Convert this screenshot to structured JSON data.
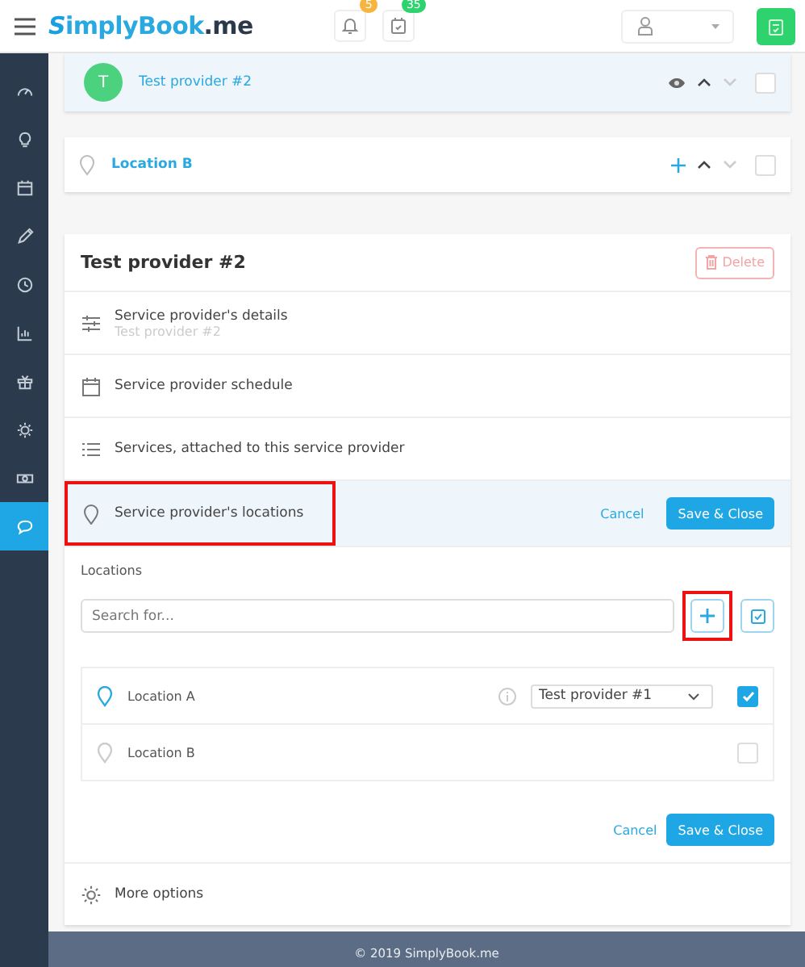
{
  "header": {
    "logo": {
      "first": "S",
      "brand": "implyBook",
      ".me": ".me"
    },
    "notifications": {
      "count": "5"
    },
    "bookings": {
      "count": "35"
    }
  },
  "sidebar": {
    "items": [
      {
        "selected": false
      },
      {
        "selected": false
      },
      {
        "selected": false
      },
      {
        "selected": false
      },
      {
        "selected": false
      },
      {
        "selected": false
      },
      {
        "selected": false
      },
      {
        "selected": false
      },
      {
        "selected": false
      },
      {
        "selected": true
      }
    ]
  },
  "list": [
    {
      "kind": "provider",
      "avatar": "T",
      "name": "Test provider #2",
      "checked": false
    },
    {
      "kind": "location",
      "name": "Location B",
      "checked": false
    }
  ],
  "editor": {
    "title": "Test provider #2",
    "delete": "Delete",
    "sections": [
      {
        "label": "Service provider's details",
        "sub": "Test provider #2",
        "highlighted": false,
        "expanded": false
      },
      {
        "label": "Service provider schedule",
        "highlighted": false,
        "expanded": false
      },
      {
        "label": "Services, attached to this service provider",
        "highlighted": false,
        "expanded": false
      },
      {
        "label": "Service provider's locations",
        "highlighted": true,
        "expanded": true,
        "cancel": "Cancel",
        "save": "Save & Close"
      }
    ],
    "locations": {
      "label": "Locations",
      "search": {
        "placeholder": "Search for..."
      },
      "add_highlighted": true,
      "rows": [
        {
          "name": "Location A",
          "provider": "Test provider #1",
          "checked": true
        },
        {
          "name": "Location B",
          "checked": false
        }
      ],
      "cancel": "Cancel",
      "save": "Save & Close"
    },
    "more": "More options"
  },
  "footer": "© 2019 SimplyBook.me"
}
